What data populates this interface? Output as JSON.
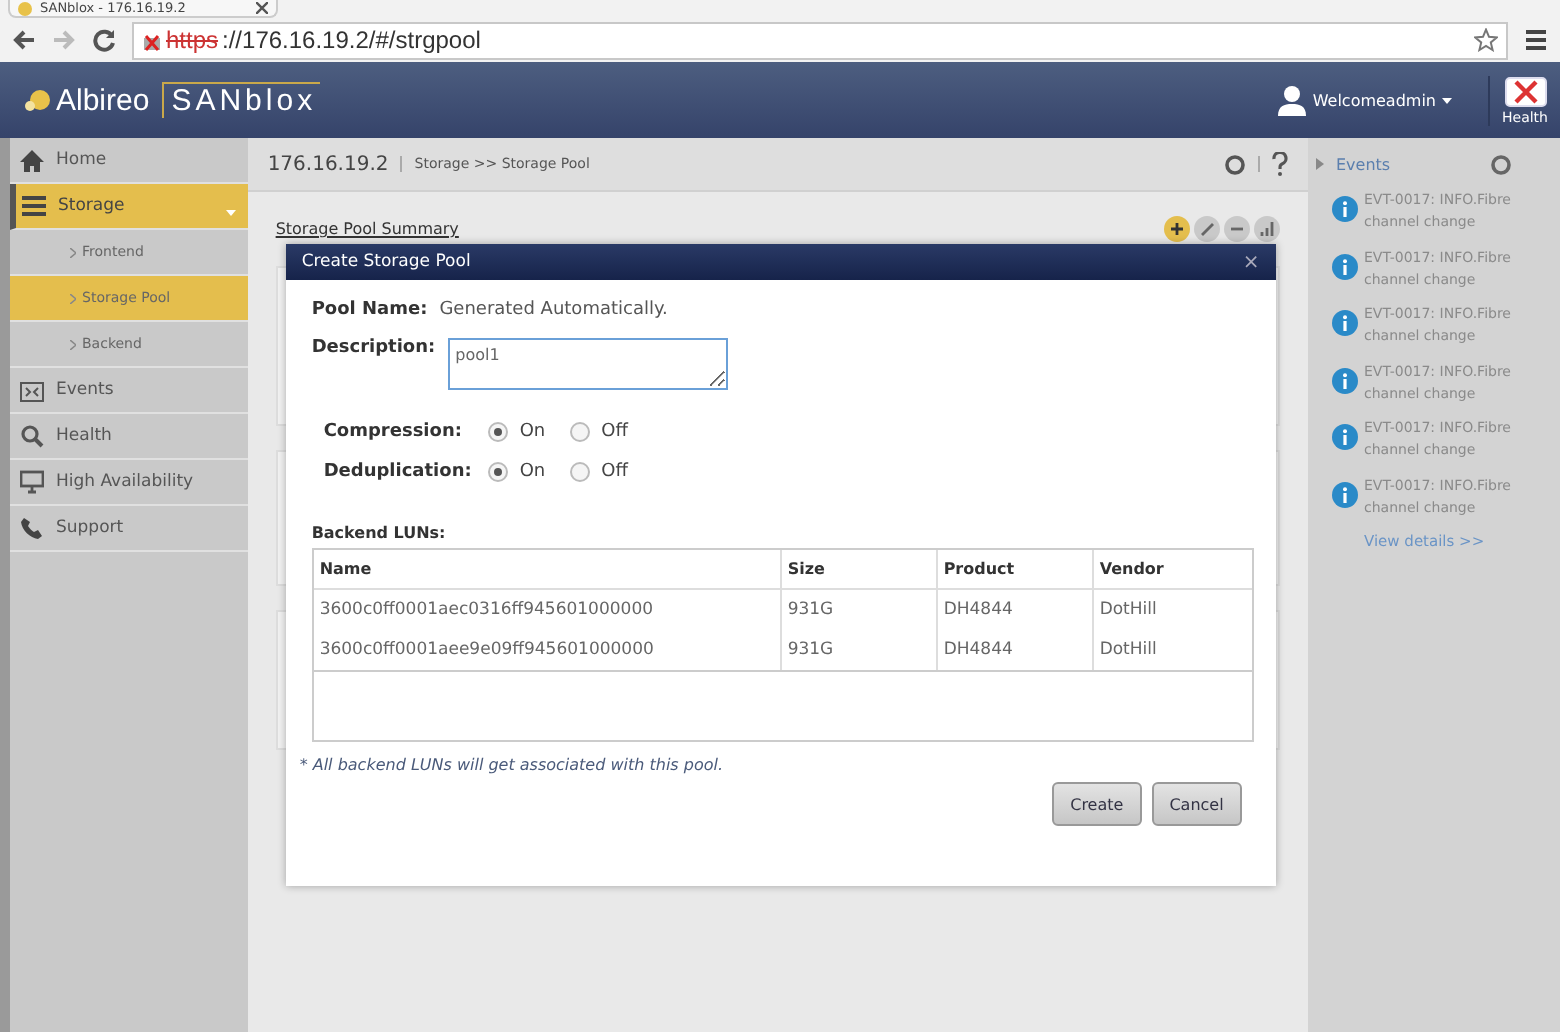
{
  "browser": {
    "tab_title": "SANblox - 176.16.19.2",
    "url_scheme": "https",
    "url_rest": "://176.16.19.2/#/strgpool"
  },
  "header": {
    "logo_left": "Albireo",
    "logo_right": "SANblox",
    "user": "Welcomeadmin",
    "health_label": "Health"
  },
  "sidebar": {
    "items": [
      {
        "label": "Home",
        "selected": false
      },
      {
        "label": "Storage",
        "selected": true,
        "expanded": true,
        "children": [
          {
            "label": "Frontend",
            "selected": false
          },
          {
            "label": "Storage Pool",
            "selected": true
          },
          {
            "label": "Backend",
            "selected": false
          }
        ]
      },
      {
        "label": "Events",
        "selected": false
      },
      {
        "label": "Health",
        "selected": false
      },
      {
        "label": "High Availability",
        "selected": false
      },
      {
        "label": "Support",
        "selected": false
      }
    ]
  },
  "breadcrumb": {
    "host": "176.16.19.2",
    "path": "Storage >> Storage Pool"
  },
  "summary_title": "Storage Pool Summary",
  "events": {
    "title": "Events",
    "items": [
      "EVT-0017: INFO.Fibre channel change",
      "EVT-0017: INFO.Fibre channel change",
      "EVT-0017: INFO.Fibre channel change",
      "EVT-0017: INFO.Fibre channel change",
      "EVT-0017: INFO.Fibre channel change",
      "EVT-0017: INFO.Fibre channel change"
    ],
    "link": "View details >>"
  },
  "dialog": {
    "title": "Create Storage Pool",
    "close": "×",
    "pool_name": {
      "label": "Pool Name:",
      "value": "Generated Automatically."
    },
    "description": {
      "label": "Description:",
      "value": "pool1"
    },
    "options": [
      {
        "label": "Compression:",
        "choices": [
          {
            "label": "On",
            "selected": true
          },
          {
            "label": "Off",
            "selected": false
          }
        ]
      },
      {
        "label": "Deduplication:",
        "choices": [
          {
            "label": "On",
            "selected": true
          },
          {
            "label": "Off",
            "selected": false
          }
        ]
      }
    ],
    "luns": {
      "title": "Backend LUNs:",
      "columns": [
        "Name",
        "Size",
        "Product",
        "Vendor"
      ],
      "rows": [
        [
          "3600c0ff0001aec0316ff945601000000",
          "931G",
          "DH4844",
          "DotHill"
        ],
        [
          "3600c0ff0001aee9e09ff945601000000",
          "931G",
          "DH4844",
          "DotHill"
        ]
      ]
    },
    "note": "* All backend LUNs will get associated with this pool.",
    "buttons": [
      "Create",
      "Cancel"
    ]
  }
}
